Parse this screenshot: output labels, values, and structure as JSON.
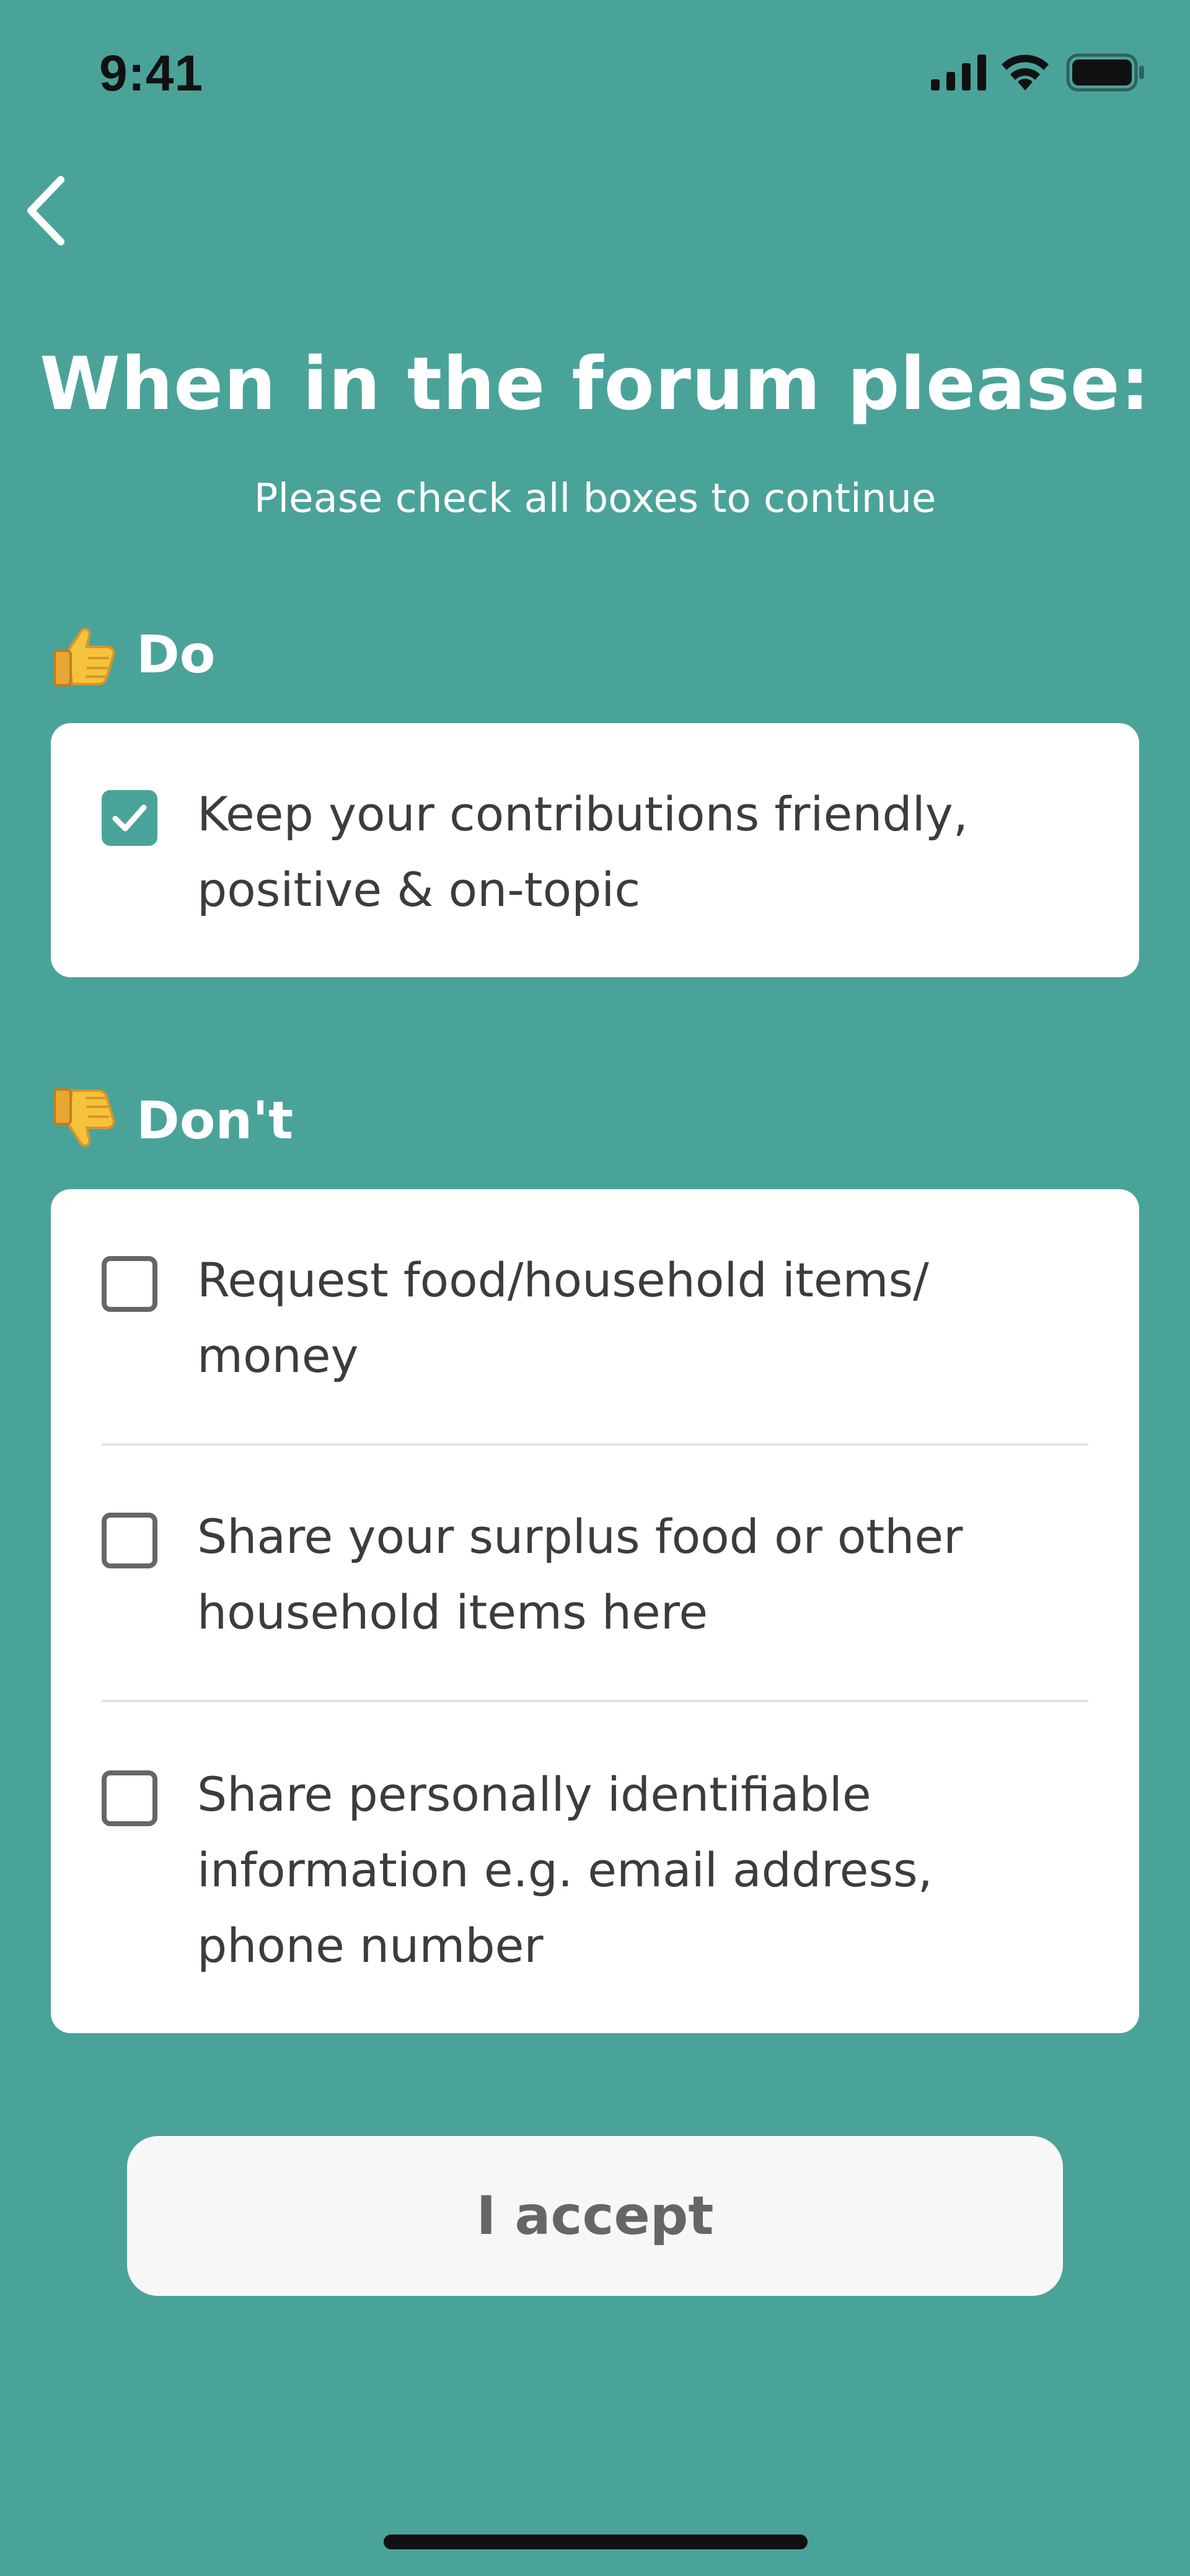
{
  "status_bar": {
    "time": "9:41"
  },
  "header": {
    "title": "When in the forum please:",
    "subtitle": "Please check all boxes to continue"
  },
  "do_section": {
    "heading": "Do",
    "icon": "thumbs-up-icon",
    "items": [
      {
        "label": "Keep your contributions friendly, positive & on-topic",
        "checked": true
      }
    ]
  },
  "dont_section": {
    "heading": "Don't",
    "icon": "thumbs-down-icon",
    "items": [
      {
        "label": "Request food/household items/ money",
        "checked": false
      },
      {
        "label": "Share your surplus food or other household items here",
        "checked": false
      },
      {
        "label": "Share personally identifiable information e.g. email address, phone number",
        "checked": false
      }
    ]
  },
  "accept_button": {
    "label": "I accept"
  },
  "colors": {
    "background": "#4aa399",
    "card": "#ffffff",
    "text": "#3c3c3c",
    "button_bg": "#f7f7f7",
    "button_text": "#666666"
  }
}
